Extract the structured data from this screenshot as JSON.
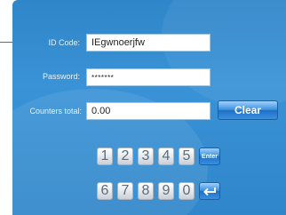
{
  "form": {
    "id_code_label": "ID Code:",
    "id_code_value": "IEgwnoerjfw",
    "password_label": "Password:",
    "password_value": "*******",
    "counters_label": "Counters total:",
    "counters_value": "0.00",
    "clear_label": "Clear"
  },
  "keypad": {
    "row1": [
      "1",
      "2",
      "3",
      "4",
      "5"
    ],
    "row2": [
      "6",
      "7",
      "8",
      "9",
      "0"
    ],
    "enter_label": "Enter",
    "back_icon": "return-arrow-icon"
  },
  "colors": {
    "panel": "#2f86c9",
    "accent_button": "#2f80d0"
  }
}
